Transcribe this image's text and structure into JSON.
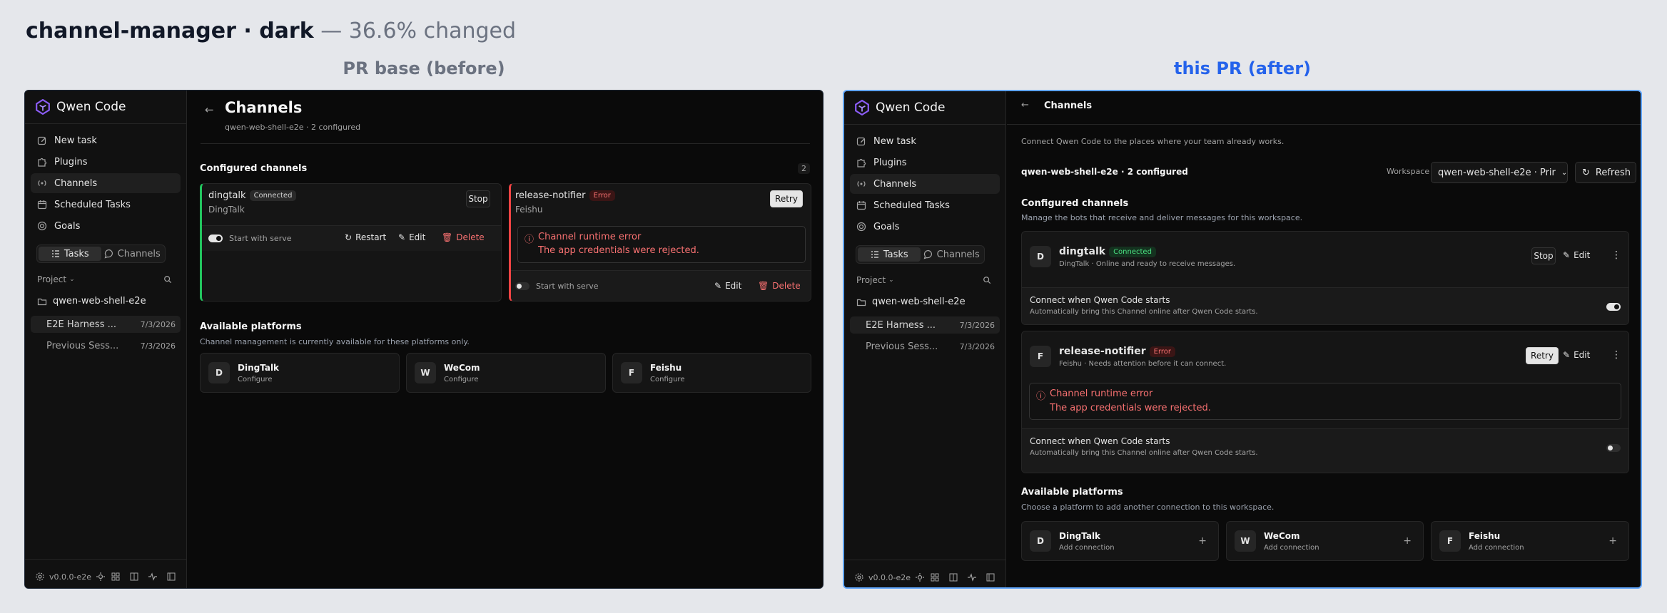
{
  "heading": {
    "title": "channel-manager · dark",
    "sep": " — ",
    "changed": "36.6% changed"
  },
  "labels": {
    "before": "PR base (before)",
    "after": "this PR (after)"
  },
  "app": {
    "name": "Qwen Code",
    "nav": [
      "New task",
      "Plugins",
      "Channels",
      "Scheduled Tasks",
      "Goals"
    ],
    "seg": {
      "tasks": "Tasks",
      "channels": "Channels"
    },
    "project_label": "Project",
    "folder": "qwen-web-shell-e2e",
    "sessions": [
      {
        "name": "E2E Harness ...",
        "date": "7/3/2026"
      },
      {
        "name": "Previous Sess...",
        "date": "7/3/2026"
      }
    ],
    "version": "v0.0.0-e2e"
  },
  "before": {
    "title": "Channels",
    "subtitle": "qwen-web-shell-e2e · 2 configured",
    "configured_title": "Configured channels",
    "count": "2",
    "dingtalk": {
      "name": "dingtalk",
      "status": "Connected",
      "platform": "DingTalk",
      "stop": "Stop",
      "serve": "Start with serve",
      "restart": "Restart",
      "edit": "Edit",
      "delete": "Delete"
    },
    "notifier": {
      "name": "release-notifier",
      "status": "Error",
      "platform": "Feishu",
      "retry": "Retry",
      "err_title": "Channel runtime error",
      "err_msg": "The app credentials were rejected.",
      "serve": "Start with serve",
      "edit": "Edit",
      "delete": "Delete"
    },
    "available_title": "Available platforms",
    "available_sub": "Channel management is currently available for these platforms only.",
    "platforms": [
      {
        "initial": "D",
        "name": "DingTalk",
        "action": "Configure"
      },
      {
        "initial": "W",
        "name": "WeCom",
        "action": "Configure"
      },
      {
        "initial": "F",
        "name": "Feishu",
        "action": "Configure"
      }
    ]
  },
  "after": {
    "title": "Channels",
    "intro": "Connect Qwen Code to the places where your team already works.",
    "workspace_summary": "qwen-web-shell-e2e · 2 configured",
    "workspace_label": "Workspace",
    "workspace_value": "qwen-web-shell-e2e · Prir",
    "refresh": "Refresh",
    "configured_title": "Configured channels",
    "configured_sub": "Manage the bots that receive and deliver messages for this workspace.",
    "dingtalk": {
      "initial": "D",
      "name": "dingtalk",
      "status": "Connected",
      "desc": "DingTalk · Online and ready to receive messages.",
      "stop": "Stop",
      "edit": "Edit",
      "sw_title": "Connect when Qwen Code starts",
      "sw_sub": "Automatically bring this Channel online after Qwen Code starts."
    },
    "notifier": {
      "initial": "F",
      "name": "release-notifier",
      "status": "Error",
      "desc": "Feishu · Needs attention before it can connect.",
      "retry": "Retry",
      "edit": "Edit",
      "err_title": "Channel runtime error",
      "err_msg": "The app credentials were rejected.",
      "sw_title": "Connect when Qwen Code starts",
      "sw_sub": "Automatically bring this Channel online after Qwen Code starts."
    },
    "available_title": "Available platforms",
    "available_sub": "Choose a platform to add another connection to this workspace.",
    "platforms": [
      {
        "initial": "D",
        "name": "DingTalk",
        "action": "Add connection"
      },
      {
        "initial": "W",
        "name": "WeCom",
        "action": "Add connection"
      },
      {
        "initial": "F",
        "name": "Feishu",
        "action": "Add connection"
      }
    ]
  },
  "colors": {
    "accent": "#2563eb",
    "connected": "#22c55e",
    "error": "#ef4444",
    "brand": "#8b5cf6"
  }
}
